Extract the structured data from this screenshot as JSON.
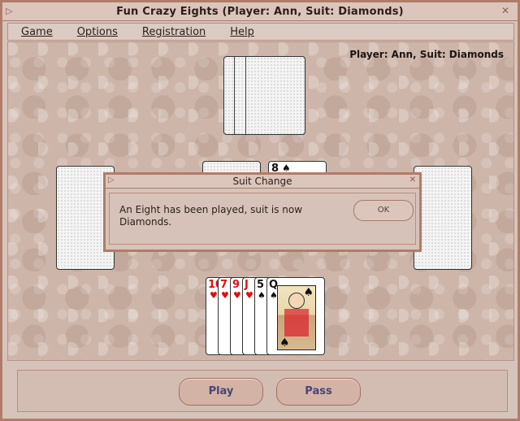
{
  "window": {
    "title": "Fun Crazy Eights (Player: Ann, Suit: Diamonds)"
  },
  "menu": {
    "items": [
      "Game",
      "Options",
      "Registration",
      "Help"
    ]
  },
  "status": {
    "player_label": "Player: Ann, Suit: Diamonds"
  },
  "dialog": {
    "title": "Suit Change",
    "message": "An Eight has been played, suit is now Diamonds.",
    "ok_label": "OK"
  },
  "hand": {
    "cards": [
      {
        "rank": "10",
        "suit": "hearts"
      },
      {
        "rank": "7",
        "suit": "hearts"
      },
      {
        "rank": "9",
        "suit": "hearts"
      },
      {
        "rank": "J",
        "suit": "hearts"
      },
      {
        "rank": "5",
        "suit": "spades"
      },
      {
        "rank": "Q",
        "suit": "spades"
      }
    ]
  },
  "discard_pile": {
    "top_rank": "8",
    "top_suit": "spades"
  },
  "actions": {
    "play_label": "Play",
    "pass_label": "Pass"
  },
  "colors": {
    "window_border": "#b07c6a",
    "button_text": "#4b4577",
    "red_suit": "#dd1111"
  }
}
